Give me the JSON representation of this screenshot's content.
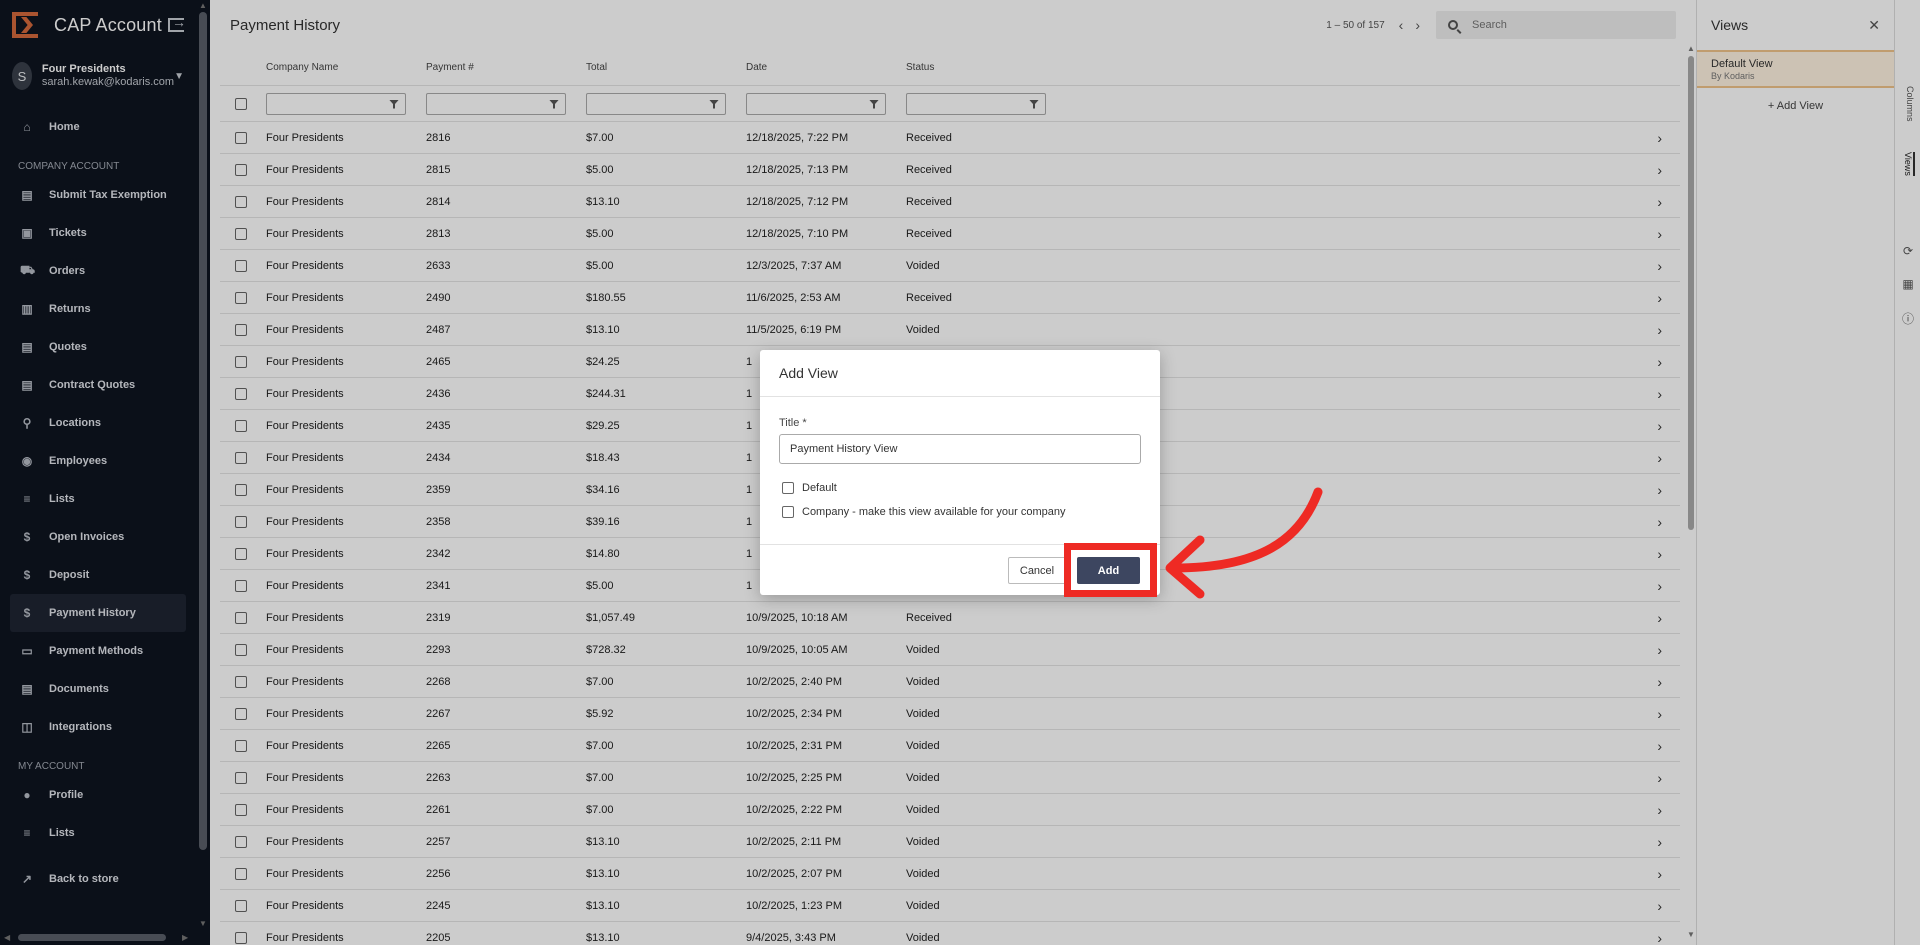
{
  "sidebar": {
    "app_title": "CAP Account",
    "user": {
      "initial": "S",
      "name": "Four Presidents",
      "email": "sarah.kewak@kodaris.com"
    },
    "home": "Home",
    "company_section": "COMPANY ACCOUNT",
    "company_items": [
      {
        "label": "Submit Tax Exemption",
        "icon": "document-icon"
      },
      {
        "label": "Tickets",
        "icon": "ticket-icon"
      },
      {
        "label": "Orders",
        "icon": "truck-icon"
      },
      {
        "label": "Returns",
        "icon": "return-box-icon"
      },
      {
        "label": "Quotes",
        "icon": "clipboard-icon"
      },
      {
        "label": "Contract Quotes",
        "icon": "clipboard-icon"
      },
      {
        "label": "Locations",
        "icon": "pin-icon"
      },
      {
        "label": "Employees",
        "icon": "people-icon"
      },
      {
        "label": "Lists",
        "icon": "list-icon"
      },
      {
        "label": "Open Invoices",
        "icon": "dollar-icon"
      },
      {
        "label": "Deposit",
        "icon": "dollar-icon"
      },
      {
        "label": "Payment History",
        "icon": "dollar-icon"
      },
      {
        "label": "Payment Methods",
        "icon": "card-icon"
      },
      {
        "label": "Documents",
        "icon": "document-icon"
      },
      {
        "label": "Integrations",
        "icon": "plug-icon"
      }
    ],
    "my_section": "MY ACCOUNT",
    "my_items": [
      {
        "label": "Profile",
        "icon": "person-icon"
      },
      {
        "label": "Lists",
        "icon": "list-icon"
      }
    ],
    "back": "Back to store",
    "active_item": "Payment History"
  },
  "header": {
    "title": "Payment History",
    "pager": "1 – 50 of 157",
    "search_placeholder": "Search"
  },
  "table": {
    "columns": [
      "Company Name",
      "Payment #",
      "Total",
      "Date",
      "Status"
    ],
    "rows": [
      [
        "Four Presidents",
        "2816",
        "$7.00",
        "12/18/2025, 7:22 PM",
        "Received"
      ],
      [
        "Four Presidents",
        "2815",
        "$5.00",
        "12/18/2025, 7:13 PM",
        "Received"
      ],
      [
        "Four Presidents",
        "2814",
        "$13.10",
        "12/18/2025, 7:12 PM",
        "Received"
      ],
      [
        "Four Presidents",
        "2813",
        "$5.00",
        "12/18/2025, 7:10 PM",
        "Received"
      ],
      [
        "Four Presidents",
        "2633",
        "$5.00",
        "12/3/2025, 7:37 AM",
        "Voided"
      ],
      [
        "Four Presidents",
        "2490",
        "$180.55",
        "11/6/2025, 2:53 AM",
        "Received"
      ],
      [
        "Four Presidents",
        "2487",
        "$13.10",
        "11/5/2025, 6:19 PM",
        "Voided"
      ],
      [
        "Four Presidents",
        "2465",
        "$24.25",
        "1",
        ""
      ],
      [
        "Four Presidents",
        "2436",
        "$244.31",
        "1",
        ""
      ],
      [
        "Four Presidents",
        "2435",
        "$29.25",
        "1",
        ""
      ],
      [
        "Four Presidents",
        "2434",
        "$18.43",
        "1",
        ""
      ],
      [
        "Four Presidents",
        "2359",
        "$34.16",
        "1",
        ""
      ],
      [
        "Four Presidents",
        "2358",
        "$39.16",
        "1",
        ""
      ],
      [
        "Four Presidents",
        "2342",
        "$14.80",
        "1",
        ""
      ],
      [
        "Four Presidents",
        "2341",
        "$5.00",
        "1",
        ""
      ],
      [
        "Four Presidents",
        "2319",
        "$1,057.49",
        "10/9/2025, 10:18 AM",
        "Received"
      ],
      [
        "Four Presidents",
        "2293",
        "$728.32",
        "10/9/2025, 10:05 AM",
        "Voided"
      ],
      [
        "Four Presidents",
        "2268",
        "$7.00",
        "10/2/2025, 2:40 PM",
        "Voided"
      ],
      [
        "Four Presidents",
        "2267",
        "$5.92",
        "10/2/2025, 2:34 PM",
        "Voided"
      ],
      [
        "Four Presidents",
        "2265",
        "$7.00",
        "10/2/2025, 2:31 PM",
        "Voided"
      ],
      [
        "Four Presidents",
        "2263",
        "$7.00",
        "10/2/2025, 2:25 PM",
        "Voided"
      ],
      [
        "Four Presidents",
        "2261",
        "$7.00",
        "10/2/2025, 2:22 PM",
        "Voided"
      ],
      [
        "Four Presidents",
        "2257",
        "$13.10",
        "10/2/2025, 2:11 PM",
        "Voided"
      ],
      [
        "Four Presidents",
        "2256",
        "$13.10",
        "10/2/2025, 2:07 PM",
        "Voided"
      ],
      [
        "Four Presidents",
        "2245",
        "$13.10",
        "10/2/2025, 1:23 PM",
        "Voided"
      ],
      [
        "Four Presidents",
        "2205",
        "$13.10",
        "9/4/2025, 3:43 PM",
        "Voided"
      ]
    ]
  },
  "views_panel": {
    "title": "Views",
    "default_view": "Default View",
    "default_by": "By Kodaris",
    "add_view": "+ Add View",
    "tabs": [
      "Columns",
      "Views"
    ]
  },
  "modal": {
    "title": "Add View",
    "field_label": "Title *",
    "field_value": "Payment History View",
    "default_label": "Default",
    "company_label": "Company - make this view available for your company",
    "cancel": "Cancel",
    "add": "Add"
  },
  "colors": {
    "accent": "#3d4660",
    "highlight": "#ee2a24",
    "sidebar": "#0e1420",
    "logo": "#d56a3c"
  }
}
